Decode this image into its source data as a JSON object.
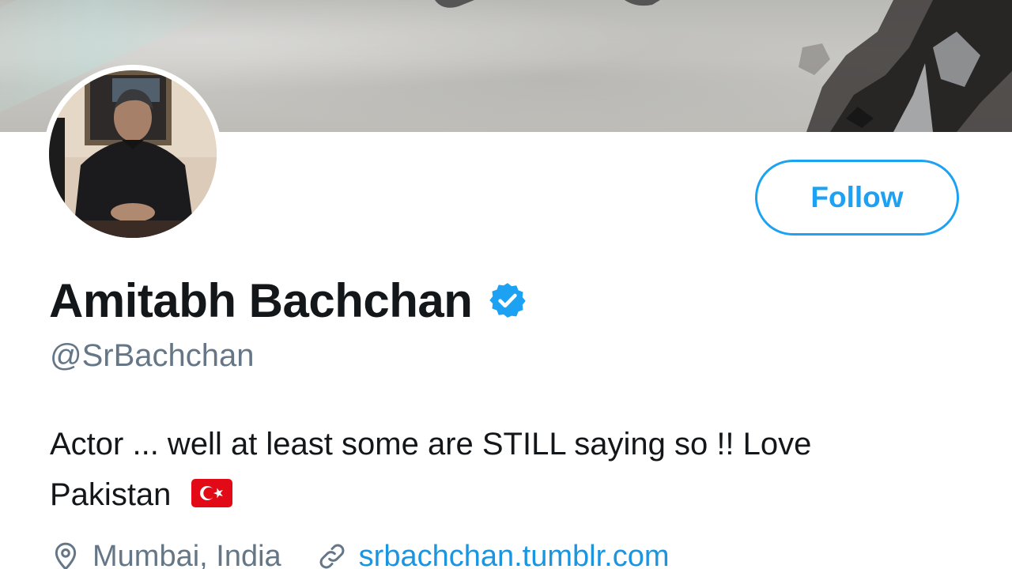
{
  "profile": {
    "display_name": "Amitabh Bachchan",
    "handle": "@SrBachchan",
    "bio_line1": "Actor ... well at least some are STILL saying so !! Love",
    "bio_line2": "Pakistan",
    "location": "Mumbai, India",
    "website": "srbachchan.tumblr.com",
    "verified": true
  },
  "actions": {
    "follow_label": "Follow"
  },
  "icons": {
    "verified": "verified-badge-icon",
    "flag": "turkey-flag-emoji",
    "location": "location-pin-icon",
    "link": "link-icon"
  },
  "colors": {
    "accent": "#1da1f2",
    "link": "#1b95e0",
    "text_primary": "#14171a",
    "text_secondary": "#657786"
  }
}
